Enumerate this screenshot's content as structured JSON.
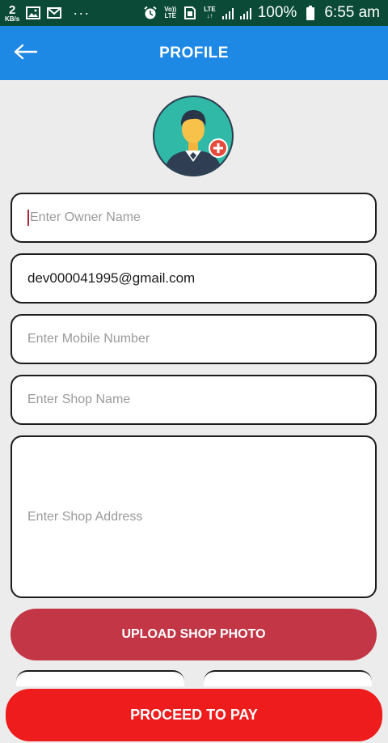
{
  "status_bar": {
    "data_rate": "2",
    "data_rate_unit": "KB/s",
    "left_icons": [
      "image-icon",
      "gmail-icon",
      "more-dots-icon"
    ],
    "more_dots": "···",
    "volte_label_top": "Vo))",
    "volte_label_bottom": "LTE",
    "lte_label_top": "LTE",
    "lte_label_bottom": "↓↑",
    "battery_percent": "100%",
    "time": "6:55 am",
    "background_color": "#0a4a36"
  },
  "app_bar": {
    "title": "PROFILE",
    "back_icon": "arrow-left-icon",
    "background_color": "#1e88e5"
  },
  "avatar": {
    "icon": "user-avatar-icon",
    "add_icon": "plus-circle-icon"
  },
  "form": {
    "owner_name": {
      "value": "",
      "placeholder": "Enter Owner Name"
    },
    "email": {
      "value": "dev000041995@gmail.com",
      "placeholder": ""
    },
    "mobile": {
      "value": "",
      "placeholder": "Enter Mobile Number"
    },
    "shop_name": {
      "value": "",
      "placeholder": "Enter Shop Name"
    },
    "shop_address": {
      "value": "",
      "placeholder": "Enter Shop Address"
    }
  },
  "buttons": {
    "upload_shop_photo": "UPLOAD SHOP PHOTO",
    "proceed_to_pay": "PROCEED TO PAY"
  },
  "colors": {
    "upload_button": "#c23646",
    "proceed_button": "#ee1c1c",
    "cursor": "#b0233b"
  }
}
